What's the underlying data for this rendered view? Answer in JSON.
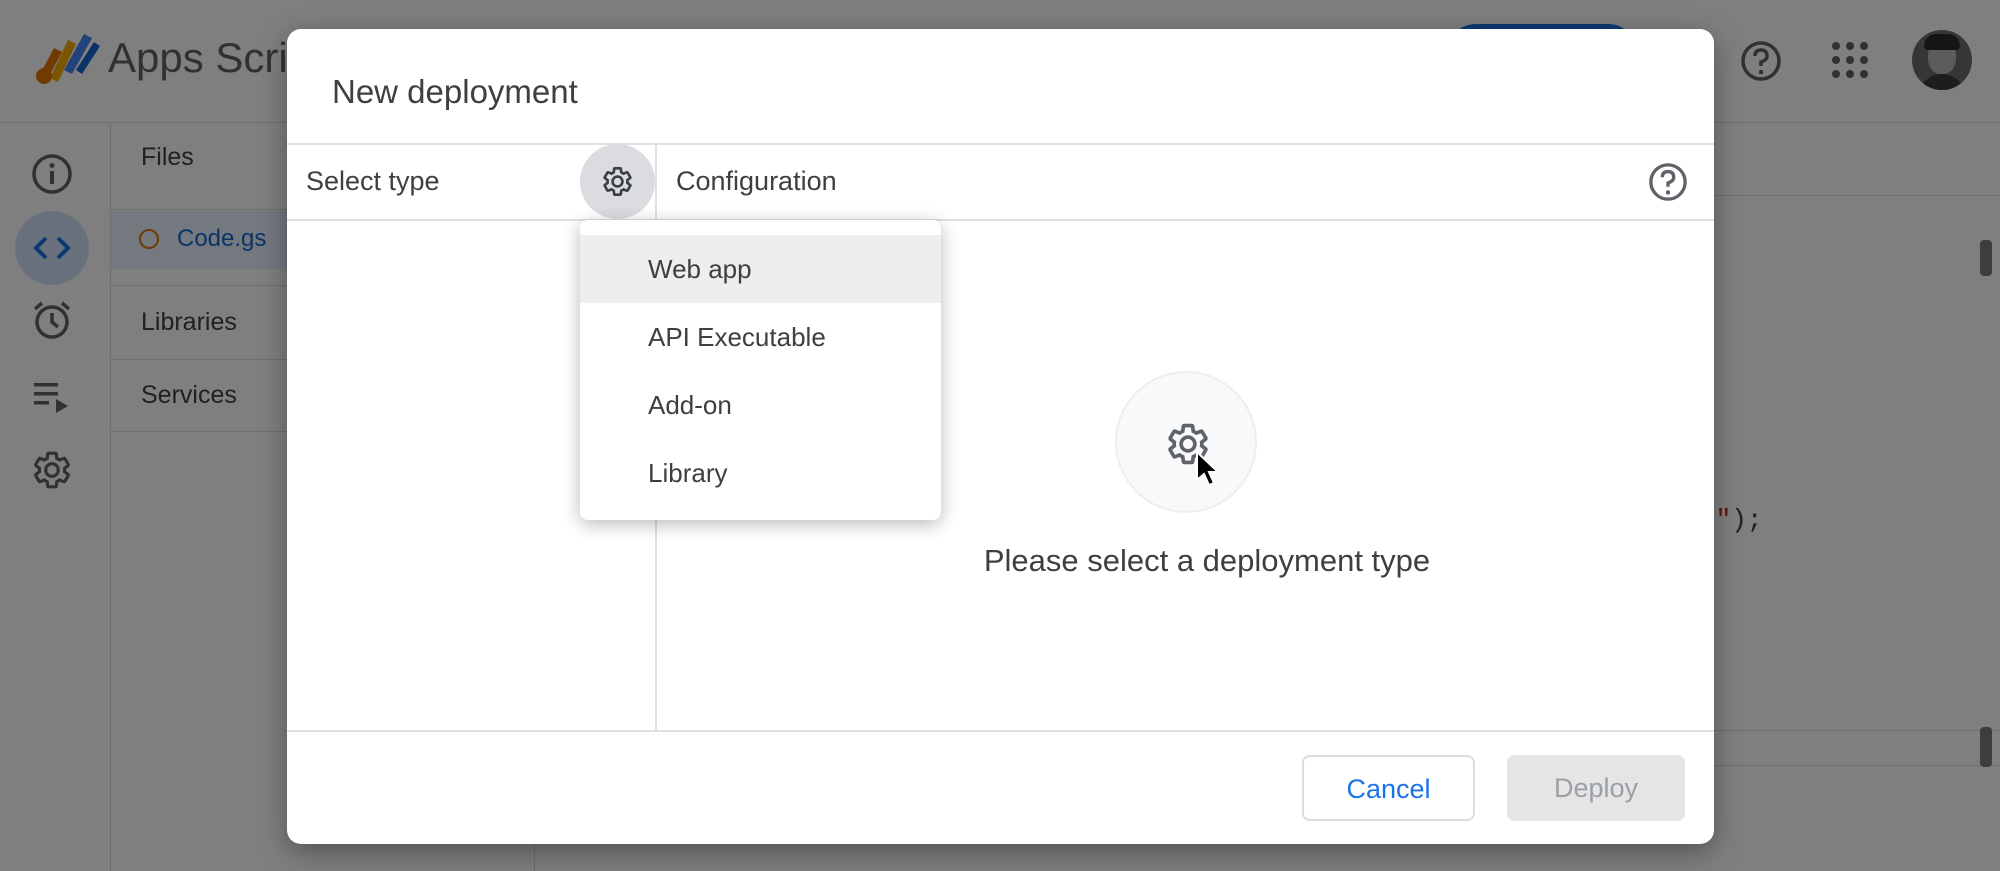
{
  "app": {
    "title": "Apps Script"
  },
  "files_panel": {
    "files_heading": "Files",
    "file_name": "Code.gs",
    "libraries_heading": "Libraries",
    "services_heading": "Services"
  },
  "editor": {
    "code_fragment_string": "s\"",
    "code_fragment_rest": ");"
  },
  "dialog": {
    "title": "New deployment",
    "select_type_label": "Select type",
    "configuration_label": "Configuration",
    "empty_message": "Please select a deployment type",
    "cancel_label": "Cancel",
    "deploy_label": "Deploy",
    "deploy_enabled": false
  },
  "type_menu": {
    "items": [
      {
        "label": "Web app",
        "highlighted": true
      },
      {
        "label": "API Executable",
        "highlighted": false
      },
      {
        "label": "Add-on",
        "highlighted": false
      },
      {
        "label": "Library",
        "highlighted": false
      }
    ]
  },
  "colors": {
    "accent": "#1a73e8",
    "scrim": "rgba(0,0,0,0.5)",
    "disabled_button": "#e5e5e5"
  },
  "icons": [
    "info-icon",
    "code-icon",
    "alarm-icon",
    "executions-icon",
    "gear-icon",
    "help-icon",
    "apps-grid-icon"
  ]
}
